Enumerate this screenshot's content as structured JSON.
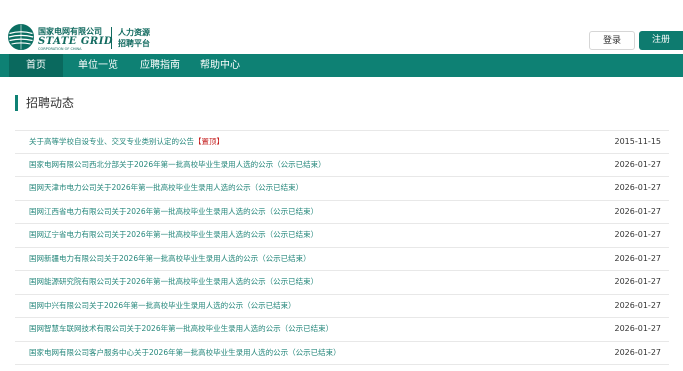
{
  "header": {
    "logo_cn": "国家电网有限公司",
    "logo_en": "STATE GRID",
    "logo_sub": "CORPORATION OF CHINA",
    "system_name_line1": "人力资源",
    "system_name_line2": "招聘平台",
    "login_label": "登录",
    "register_label": "注册"
  },
  "nav": {
    "items": [
      {
        "label": "首页",
        "active": true
      },
      {
        "label": "单位一览",
        "active": false
      },
      {
        "label": "应聘指南",
        "active": false
      },
      {
        "label": "帮助中心",
        "active": false
      }
    ]
  },
  "section": {
    "title": "招聘动态"
  },
  "notices": [
    {
      "title": "关于高等学校自设专业、交叉专业类别认定的公告",
      "tag": "【置顶】",
      "date": "2015-11-15"
    },
    {
      "title": "国家电网有限公司西北分部关于2026年第一批高校毕业生录用人选的公示（公示已结束）",
      "tag": "",
      "date": "2026-01-27"
    },
    {
      "title": "国网天津市电力公司关于2026年第一批高校毕业生录用人选的公示（公示已结束）",
      "tag": "",
      "date": "2026-01-27"
    },
    {
      "title": "国网江西省电力有限公司关于2026年第一批高校毕业生录用人选的公示（公示已结束）",
      "tag": "",
      "date": "2026-01-27"
    },
    {
      "title": "国网辽宁省电力有限公司关于2026年第一批高校毕业生录用人选的公示（公示已结束）",
      "tag": "",
      "date": "2026-01-27"
    },
    {
      "title": "国网新疆电力有限公司关于2026年第一批高校毕业生录用人选的公示（公示已结束）",
      "tag": "",
      "date": "2026-01-27"
    },
    {
      "title": "国网能源研究院有限公司关于2026年第一批高校毕业生录用人选的公示（公示已结束）",
      "tag": "",
      "date": "2026-01-27"
    },
    {
      "title": "国网中兴有限公司关于2026年第一批高校毕业生录用人选的公示（公示已结束）",
      "tag": "",
      "date": "2026-01-27"
    },
    {
      "title": "国网智慧车联网技术有限公司关于2026年第一批高校毕业生录用人选的公示（公示已结束）",
      "tag": "",
      "date": "2026-01-27"
    },
    {
      "title": "国家电网有限公司客户服务中心关于2026年第一批高校毕业生录用人选的公示（公示已结束）",
      "tag": "",
      "date": "2026-01-27"
    }
  ],
  "colors": {
    "brand": "#0e8174",
    "nav_active": "#0a695e",
    "link": "#25877b",
    "tag": "#c41c1c"
  }
}
